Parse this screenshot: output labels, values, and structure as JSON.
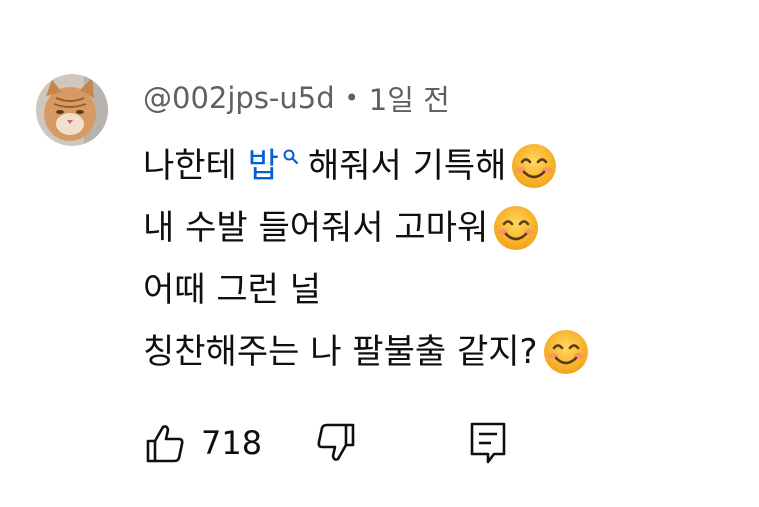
{
  "comment": {
    "author": "@002jps-u5d",
    "separator": "•",
    "time": "1일 전",
    "lines": [
      {
        "before": "나한테 ",
        "link": "밥",
        "after": "해줘서 기특해",
        "emoji": "smiling-face-icon"
      },
      {
        "before": "내 수발 들어줘서 고마워",
        "emoji": "smiling-face-icon"
      },
      {
        "before": "어때 그런 널"
      },
      {
        "before": "칭찬해주는 나 팔불출 같지?",
        "emoji": "smiling-face-icon"
      }
    ]
  },
  "actions": {
    "like_count": "718",
    "like_icon": "thumbs-up-icon",
    "dislike_icon": "thumbs-down-icon",
    "reply_icon": "reply-comment-icon"
  },
  "colors": {
    "link": "#065fd4",
    "meta": "#606060",
    "text": "#0f0f0f"
  }
}
